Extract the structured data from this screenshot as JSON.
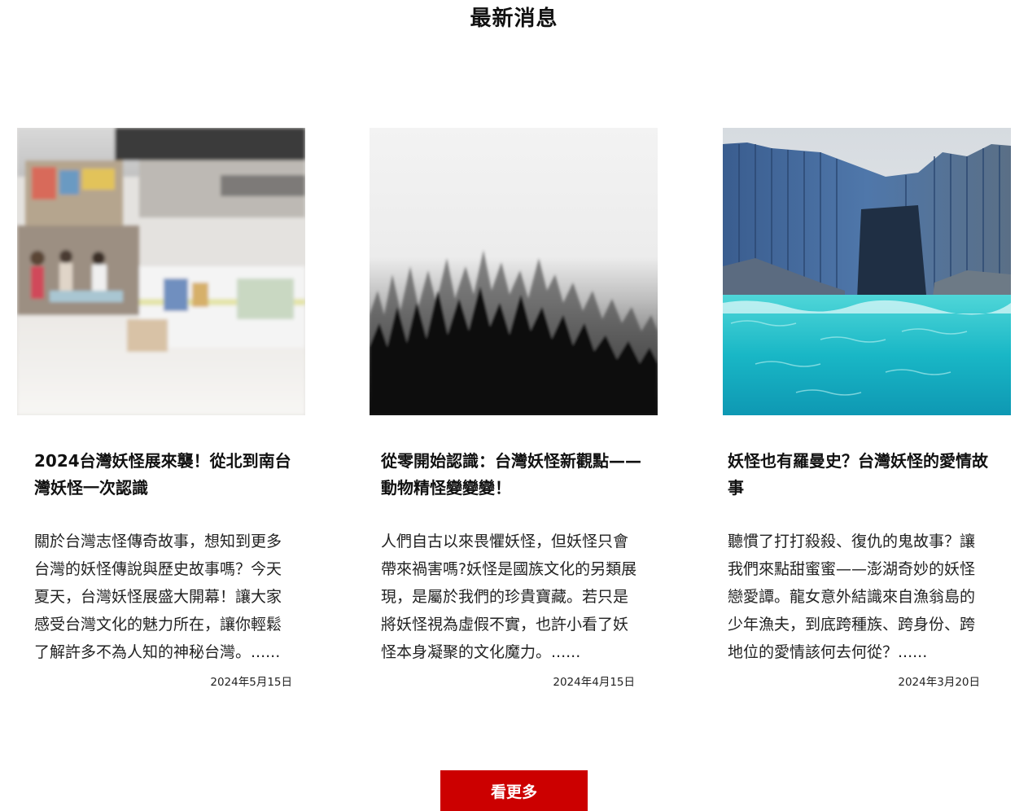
{
  "section": {
    "title": "最新消息"
  },
  "articles": [
    {
      "title": "2024台灣妖怪展來襲！從北到南台灣妖怪一次認識",
      "excerpt": "關於台灣志怪傳奇故事，想知到更多台灣的妖怪傳說與歷史故事嗎？今天夏天，台灣妖怪展盛大開幕！讓大家感受台灣文化的魅力所在，讓你輕鬆了解許多不為人知的神秘台灣。......",
      "date": "2024年5月15日",
      "image": "shopping-mall-photo"
    },
    {
      "title": "從零開始認識：台灣妖怪新觀點——動物精怪變變變！",
      "excerpt": "人們自古以來畏懼妖怪，但妖怪只會帶來禍害嗎?妖怪是國族文化的另類展現，是屬於我們的珍貴寶藏。若只是將妖怪視為虛假不實，也許小看了妖怪本身凝聚的文化魔力。......",
      "date": "2024年4月15日",
      "image": "misty-forest-photo"
    },
    {
      "title": "妖怪也有羅曼史？台灣妖怪的愛情故事",
      "excerpt": "聽慣了打打殺殺、復仇的鬼故事？讓我們來點甜蜜蜜——澎湖奇妙的妖怪戀愛譚。龍女意外結識來自漁翁島的少年漁夫，到底跨種族、跨身份、跨地位的愛情該何去何從？......",
      "date": "2024年3月20日",
      "image": "basalt-cliff-sea-photo"
    }
  ],
  "more_button": {
    "label": "看更多",
    "color": "#cc0000"
  }
}
